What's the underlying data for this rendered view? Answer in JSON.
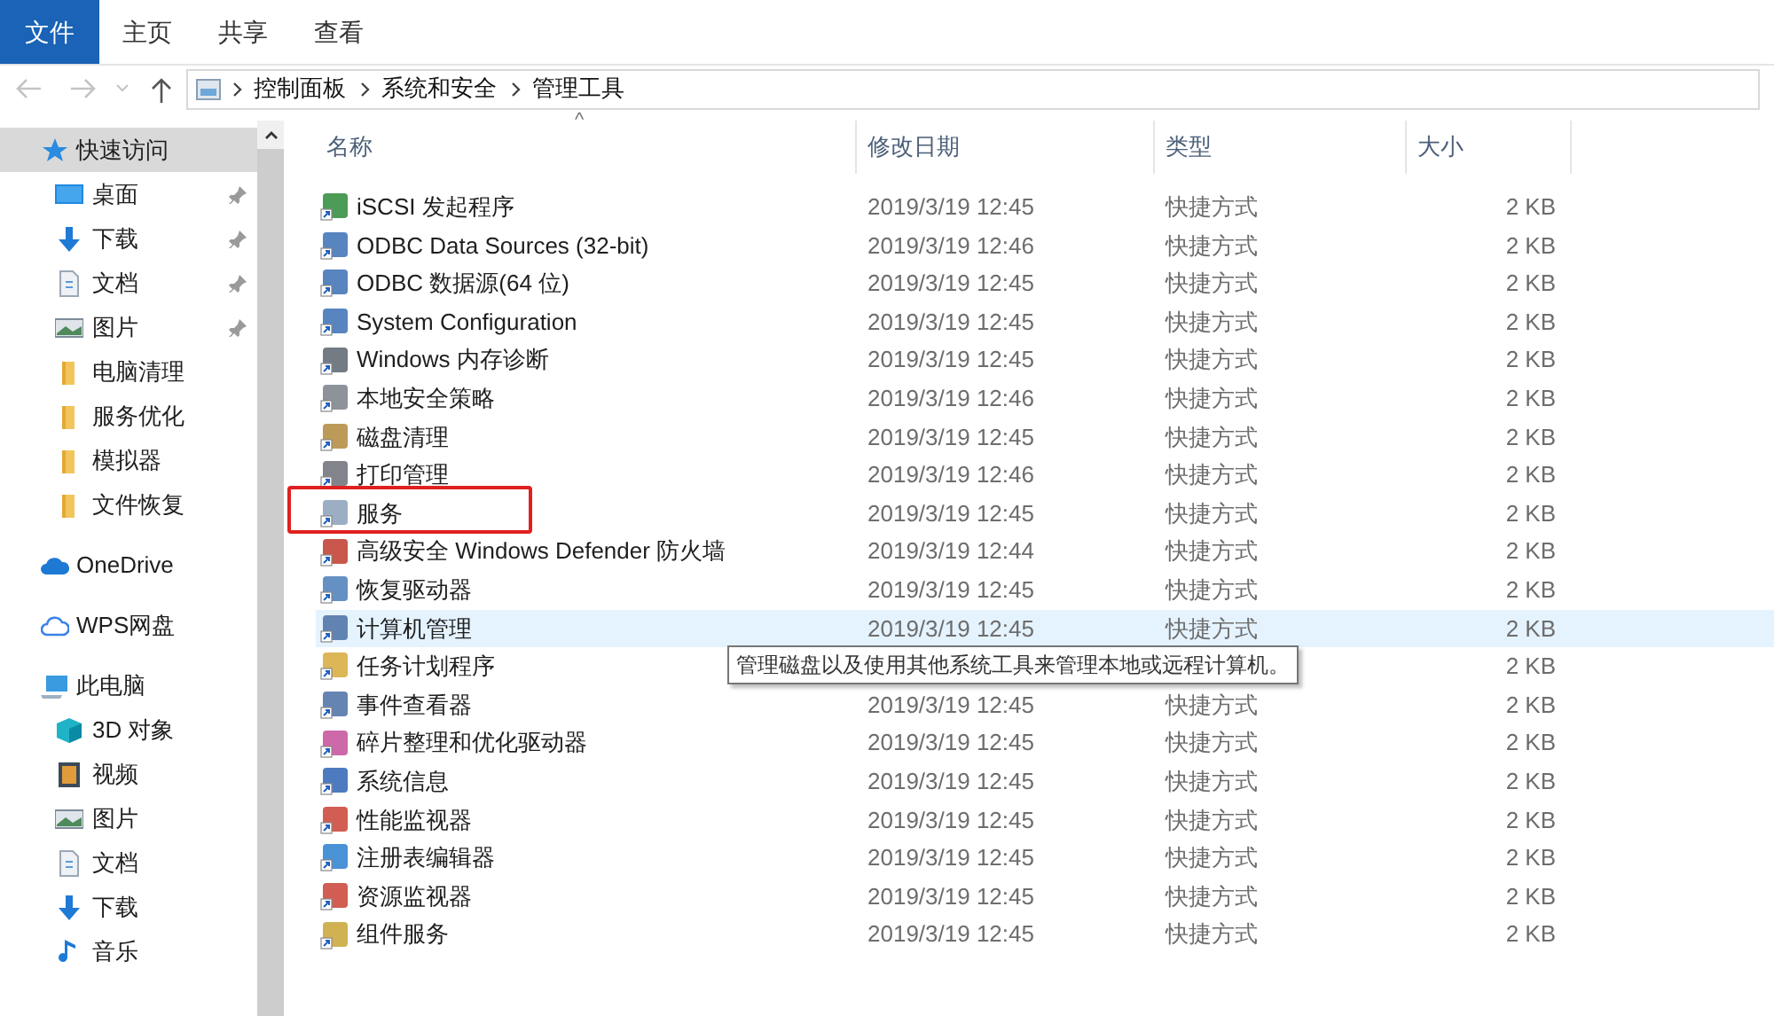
{
  "ribbon_tabs": [
    {
      "label": "文件",
      "selected": true
    },
    {
      "label": "主页",
      "selected": false
    },
    {
      "label": "共享",
      "selected": false
    },
    {
      "label": "查看",
      "selected": false
    }
  ],
  "address_bar": {
    "breadcrumbs": [
      "控制面板",
      "系统和安全",
      "管理工具"
    ]
  },
  "sidebar": {
    "items": [
      {
        "label": "快速访问",
        "kind": "star",
        "selected": true,
        "children": [
          {
            "label": "桌面",
            "kind": "desktop",
            "pinned": true
          },
          {
            "label": "下载",
            "kind": "download",
            "pinned": true
          },
          {
            "label": "文档",
            "kind": "document",
            "pinned": true
          },
          {
            "label": "图片",
            "kind": "picture",
            "pinned": true
          },
          {
            "label": "电脑清理",
            "kind": "folder",
            "pinned": false
          },
          {
            "label": "服务优化",
            "kind": "folder",
            "pinned": false
          },
          {
            "label": "模拟器",
            "kind": "folder",
            "pinned": false
          },
          {
            "label": "文件恢复",
            "kind": "folder",
            "pinned": false
          }
        ]
      },
      {
        "label": "OneDrive",
        "kind": "cloud",
        "selected": false
      },
      {
        "label": "WPS网盘",
        "kind": "cloud-outline",
        "selected": false
      },
      {
        "label": "此电脑",
        "kind": "computer",
        "selected": false,
        "children": [
          {
            "label": "3D 对象",
            "kind": "cube",
            "pinned": false
          },
          {
            "label": "视频",
            "kind": "video",
            "pinned": false
          },
          {
            "label": "图片",
            "kind": "picture",
            "pinned": false
          },
          {
            "label": "文档",
            "kind": "document",
            "pinned": false
          },
          {
            "label": "下载",
            "kind": "download",
            "pinned": false
          },
          {
            "label": "音乐",
            "kind": "music",
            "pinned": false
          }
        ]
      }
    ]
  },
  "table": {
    "sort_indicator": "^",
    "columns": [
      "名称",
      "修改日期",
      "类型",
      "大小"
    ],
    "rows": [
      {
        "name": "iSCSI 发起程序",
        "date": "2019/3/19 12:45",
        "type": "快捷方式",
        "size": "2 KB",
        "hovered": false,
        "highlighted": false
      },
      {
        "name": "ODBC Data Sources (32-bit)",
        "date": "2019/3/19 12:46",
        "type": "快捷方式",
        "size": "2 KB",
        "hovered": false,
        "highlighted": false
      },
      {
        "name": "ODBC 数据源(64 位)",
        "date": "2019/3/19 12:45",
        "type": "快捷方式",
        "size": "2 KB",
        "hovered": false,
        "highlighted": false
      },
      {
        "name": "System Configuration",
        "date": "2019/3/19 12:45",
        "type": "快捷方式",
        "size": "2 KB",
        "hovered": false,
        "highlighted": false
      },
      {
        "name": "Windows 内存诊断",
        "date": "2019/3/19 12:45",
        "type": "快捷方式",
        "size": "2 KB",
        "hovered": false,
        "highlighted": false
      },
      {
        "name": "本地安全策略",
        "date": "2019/3/19 12:46",
        "type": "快捷方式",
        "size": "2 KB",
        "hovered": false,
        "highlighted": false
      },
      {
        "name": "磁盘清理",
        "date": "2019/3/19 12:45",
        "type": "快捷方式",
        "size": "2 KB",
        "hovered": false,
        "highlighted": false
      },
      {
        "name": "打印管理",
        "date": "2019/3/19 12:46",
        "type": "快捷方式",
        "size": "2 KB",
        "hovered": false,
        "highlighted": false
      },
      {
        "name": "服务",
        "date": "2019/3/19 12:45",
        "type": "快捷方式",
        "size": "2 KB",
        "hovered": false,
        "highlighted": true
      },
      {
        "name": "高级安全 Windows Defender 防火墙",
        "date": "2019/3/19 12:44",
        "type": "快捷方式",
        "size": "2 KB",
        "hovered": false,
        "highlighted": false
      },
      {
        "name": "恢复驱动器",
        "date": "2019/3/19 12:45",
        "type": "快捷方式",
        "size": "2 KB",
        "hovered": false,
        "highlighted": false
      },
      {
        "name": "计算机管理",
        "date": "2019/3/19 12:45",
        "type": "快捷方式",
        "size": "2 KB",
        "hovered": true,
        "highlighted": false
      },
      {
        "name": "任务计划程序",
        "size": "2 KB",
        "hovered": false,
        "highlighted": false
      },
      {
        "name": "事件查看器",
        "date": "2019/3/19 12:45",
        "type": "快捷方式",
        "size": "2 KB",
        "hovered": false,
        "highlighted": false
      },
      {
        "name": "碎片整理和优化驱动器",
        "date": "2019/3/19 12:45",
        "type": "快捷方式",
        "size": "2 KB",
        "hovered": false,
        "highlighted": false
      },
      {
        "name": "系统信息",
        "date": "2019/3/19 12:45",
        "type": "快捷方式",
        "size": "2 KB",
        "hovered": false,
        "highlighted": false
      },
      {
        "name": "性能监视器",
        "date": "2019/3/19 12:45",
        "type": "快捷方式",
        "size": "2 KB",
        "hovered": false,
        "highlighted": false
      },
      {
        "name": "注册表编辑器",
        "date": "2019/3/19 12:45",
        "type": "快捷方式",
        "size": "2 KB",
        "hovered": false,
        "highlighted": false
      },
      {
        "name": "资源监视器",
        "date": "2019/3/19 12:45",
        "type": "快捷方式",
        "size": "2 KB",
        "hovered": false,
        "highlighted": false
      },
      {
        "name": "组件服务",
        "date": "2019/3/19 12:45",
        "type": "快捷方式",
        "size": "2 KB",
        "hovered": false,
        "highlighted": false
      }
    ]
  },
  "tooltip": {
    "text": "管理磁盘以及使用其他系统工具来管理本地或远程计算机。"
  }
}
